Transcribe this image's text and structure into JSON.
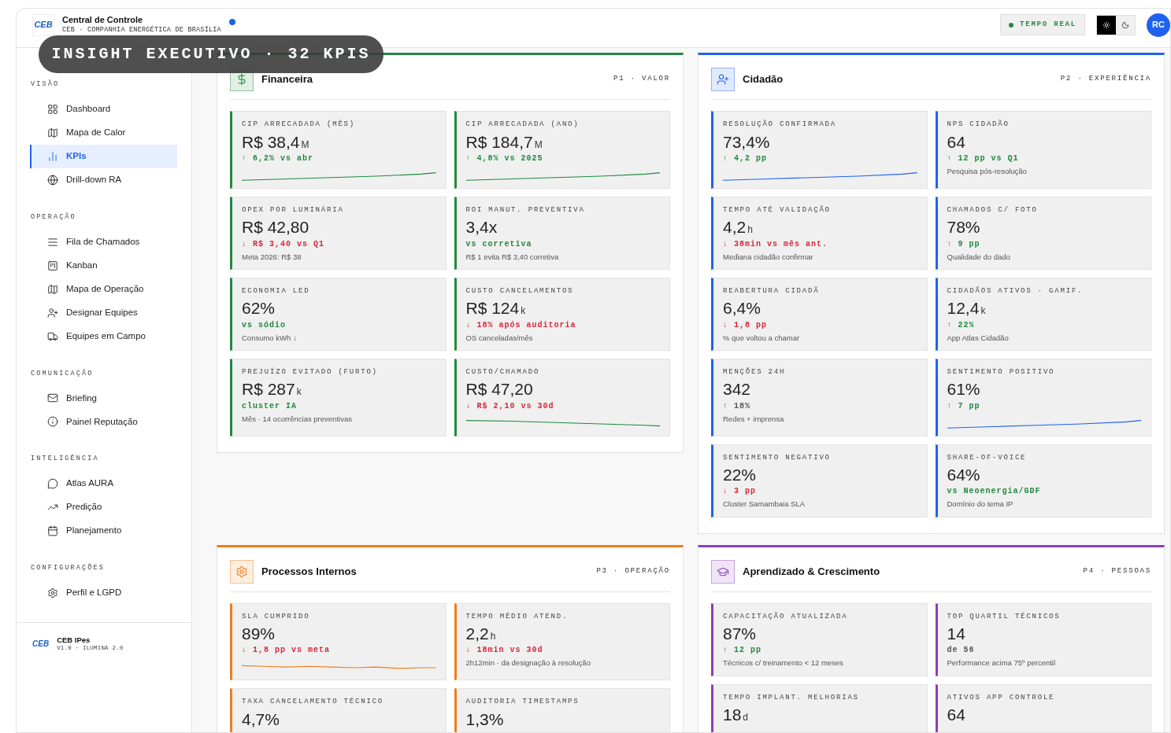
{
  "header": {
    "logo": "CEB",
    "title": "Central de Controle",
    "subtitle": "CEB · COMPANHIA ENERGÉTICA DE BRASÍLIA",
    "live_badge": "TEMPO REAL",
    "theme": [
      {
        "kind": "light",
        "selected": true
      },
      {
        "kind": "dark",
        "selected": false
      }
    ],
    "avatar": "RC"
  },
  "overlay": "INSIGHT EXECUTIVO · 32 KPIS",
  "sidebar": {
    "groups": [
      {
        "title": "VISÃO",
        "items": [
          {
            "label": "Dashboard",
            "selected": false
          },
          {
            "label": "Mapa de Calor",
            "selected": false
          },
          {
            "label": "KPIs",
            "selected": true
          },
          {
            "label": "Drill-down RA",
            "selected": false
          }
        ]
      },
      {
        "title": "OPERAÇÃO",
        "items": [
          {
            "label": "Fila de Chamados",
            "selected": false
          },
          {
            "label": "Kanban",
            "selected": false
          },
          {
            "label": "Mapa de Operação",
            "selected": false
          },
          {
            "label": "Designar Equipes",
            "selected": false
          },
          {
            "label": "Equipes em Campo",
            "selected": false
          }
        ]
      },
      {
        "title": "COMUNICAÇÃO",
        "items": [
          {
            "label": "Briefing",
            "selected": false
          },
          {
            "label": "Painel Reputação",
            "selected": false
          }
        ]
      },
      {
        "title": "INTELIGÊNCIA",
        "items": [
          {
            "label": "Atlas AURA",
            "selected": false
          },
          {
            "label": "Predição",
            "selected": false
          },
          {
            "label": "Planejamento",
            "selected": false
          }
        ]
      },
      {
        "title": "CONFIGURAÇÕES",
        "items": [
          {
            "label": "Perfil e LGPD",
            "selected": false
          }
        ]
      }
    ],
    "footer": {
      "logo": "CEB",
      "name": "CEB IPes",
      "version": "V1.0 · ILUMINA 2.0"
    }
  },
  "sections": [
    {
      "kind": "money",
      "title": "Financeira",
      "tag": "P1 · VALOR",
      "color": "#22883f",
      "cards": [
        {
          "kind": "rising",
          "label": "CIP ARRECADADA (MÊS)",
          "value": "R$ 38,4",
          "unit": "M",
          "delta": "↑ 6,2% vs abr",
          "color": "#22883f"
        },
        {
          "kind": "rising",
          "label": "CIP ARRECADADA (ANO)",
          "value": "R$ 184,7",
          "unit": "M",
          "delta": "↑ 4,8% vs 2025",
          "color": "#22883f"
        },
        {
          "kind": "plain",
          "label": "OPEX POR LUMINÁRIA",
          "value": "R$ 42,80",
          "delta": "↓ R$ 3,40 vs Q1",
          "color": "#d8263a",
          "note": "Meta 2026: R$ 38"
        },
        {
          "kind": "plain",
          "label": "ROI MANUT. PREVENTIVA",
          "value": "3,4x",
          "delta": "vs corretiva",
          "color": "#22883f",
          "note": "R$ 1 evita R$ 3,40 corretiva"
        },
        {
          "kind": "plain",
          "label": "ECONOMIA LED",
          "value": "62%",
          "delta": "vs sódio",
          "color": "#22883f",
          "note": "Consumo kWh ↓"
        },
        {
          "kind": "plain",
          "label": "CUSTO CANCELAMENTOS",
          "value": "R$ 124",
          "unit": "k",
          "delta": "↓ 18% após auditoria",
          "color": "#d8263a",
          "note": "OS canceladas/mês"
        },
        {
          "kind": "plain",
          "label": "PREJUÍZO EVITADO (FURTO)",
          "value": "R$ 287",
          "unit": "k",
          "delta": "cluster IA",
          "color": "#22883f",
          "note": "Mês · 14 ocorrências preventivas"
        },
        {
          "kind": "falling",
          "label": "CUSTO/CHAMADO",
          "value": "R$ 47,20",
          "delta": "↓ R$ 2,10 vs 30d",
          "color": "#d8263a"
        }
      ]
    },
    {
      "kind": "citizen",
      "title": "Cidadão",
      "tag": "P2 · EXPERIÊNCIA",
      "color": "#1f62f0",
      "cards": [
        {
          "kind": "rising",
          "label": "RESOLUÇÃO CONFIRMADA",
          "value": "73,4%",
          "delta": "↑ 4,2 pp",
          "color": "#22883f"
        },
        {
          "kind": "plain",
          "label": "NPS CIDADÃO",
          "value": "64",
          "delta": "↑ 12 pp vs Q1",
          "color": "#22883f",
          "note": "Pesquisa pós-resolução"
        },
        {
          "kind": "plain",
          "label": "TEMPO ATÉ VALIDAÇÃO",
          "value": "4,2",
          "unit": "h",
          "delta": "↓ 38min vs mês ant.",
          "color": "#d8263a",
          "note": "Mediana cidadão confirmar"
        },
        {
          "kind": "plain",
          "label": "CHAMADOS C/ FOTO",
          "value": "78%",
          "delta": "↑ 9 pp",
          "color": "#22883f",
          "note": "Qualidade do dado"
        },
        {
          "kind": "plain",
          "label": "REABERTURA CIDADÃ",
          "value": "6,4%",
          "delta": "↓ 1,8 pp",
          "color": "#d8263a",
          "note": "% que voltou a chamar"
        },
        {
          "kind": "plain",
          "label": "CIDADÃOS ATIVOS · GAMIF.",
          "value": "12,4",
          "unit": "k",
          "delta": "↑ 22%",
          "color": "#22883f",
          "note": "App Atlas Cidadão"
        },
        {
          "kind": "plain",
          "label": "MENÇÕES 24H",
          "value": "342",
          "delta": "↑ 18%",
          "color": "#555555",
          "note": "Redes + imprensa"
        },
        {
          "kind": "rising",
          "label": "SENTIMENTO POSITIVO",
          "value": "61%",
          "delta": "↑ 7 pp",
          "color": "#22883f"
        },
        {
          "kind": "plain",
          "label": "SENTIMENTO NEGATIVO",
          "value": "22%",
          "delta": "↓ 3 pp",
          "color": "#d8263a",
          "note": "Cluster Samambaia SLA"
        },
        {
          "kind": "plain",
          "label": "SHARE-OF-VOICE",
          "value": "64%",
          "delta": "vs Neoenergia/GDF",
          "color": "#22883f",
          "note": "Domínio do tema IP"
        }
      ]
    },
    {
      "kind": "process",
      "title": "Processos Internos",
      "tag": "P3 · OPERAÇÃO",
      "color": "#ee7d1a",
      "cards": [
        {
          "kind": "wavy",
          "label": "SLA CUMPRIDO",
          "value": "89%",
          "delta": "↓ 1,8 pp vs meta",
          "color": "#d8263a"
        },
        {
          "kind": "plain",
          "label": "TEMPO MÉDIO ATEND.",
          "value": "2,2",
          "unit": "h",
          "delta": "↓ 18min vs 30d",
          "color": "#d8263a",
          "note": "2h12min · da designação à resolução"
        },
        {
          "kind": "plain",
          "label": "TAXA CANCELAMENTO TÉCNICO",
          "value": "4,7%"
        },
        {
          "kind": "plain",
          "label": "AUDITORIA TIMESTAMPS",
          "value": "1,3%"
        }
      ]
    },
    {
      "kind": "learning",
      "title": "Aprendizado & Crescimento",
      "tag": "P4 · PESSOAS",
      "color": "#8b3fb8",
      "cards": [
        {
          "kind": "plain",
          "label": "CAPACITAÇÃO ATUALIZADA",
          "value": "87%",
          "delta": "↑ 12 pp",
          "color": "#22883f",
          "note": "Técnicos c/ treinamento < 12 meses"
        },
        {
          "kind": "plain",
          "label": "TOP QUARTIL TÉCNICOS",
          "value": "14",
          "delta": "de 56",
          "color": "#555555",
          "note": "Performance acima 75º percentil"
        },
        {
          "kind": "plain",
          "label": "TEMPO IMPLANT. MELHORIAS",
          "value": "18",
          "unit": "d"
        },
        {
          "kind": "plain",
          "label": "ATIVOS APP CONTROLE",
          "value": "64"
        }
      ]
    }
  ]
}
